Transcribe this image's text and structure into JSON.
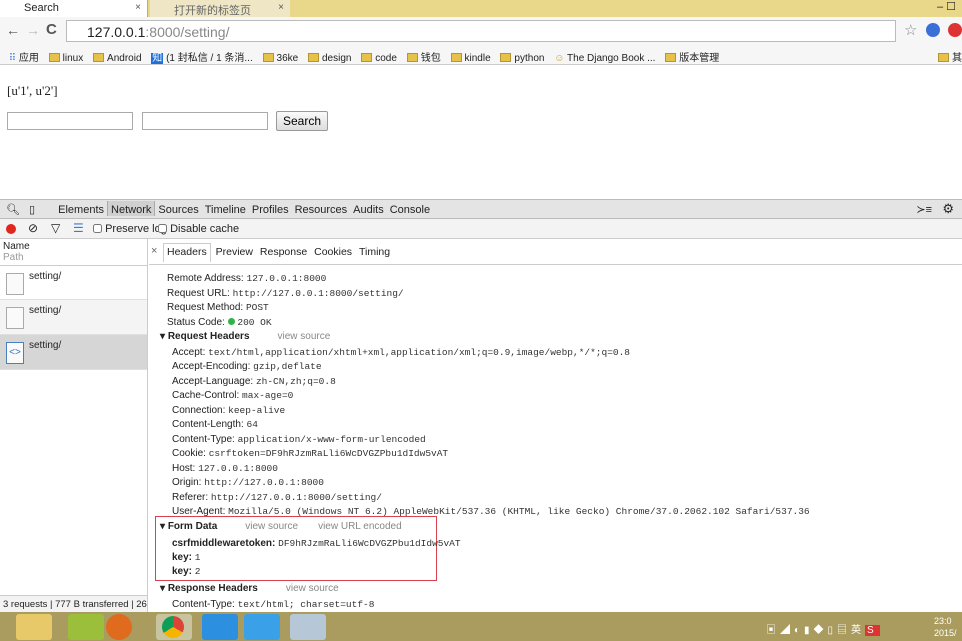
{
  "browser": {
    "tabs": [
      {
        "label": "Search",
        "close": "×"
      },
      {
        "label": "打开新的标签页",
        "close": "×"
      }
    ],
    "url_host": "127.0.0.1",
    "url_rest": ":8000/setting/",
    "bookmarks": [
      "应用",
      "linux",
      "Android",
      "(1 封私信 / 1 条消...",
      "36ke",
      "design",
      "code",
      "钱包",
      "kindle",
      "python",
      "The Django Book ...",
      "版本管理"
    ],
    "bookmarks_other": "其"
  },
  "page": {
    "output": "[u'1', u'2']",
    "input1": "",
    "input2": "",
    "search_button": "Search"
  },
  "devtools": {
    "panels": [
      "Elements",
      "Network",
      "Sources",
      "Timeline",
      "Profiles",
      "Resources",
      "Audits",
      "Console"
    ],
    "active_panel": "Network",
    "preserve_log": "Preserve log",
    "disable_cache": "Disable cache",
    "col_name": "Name",
    "col_path": "Path",
    "requests": [
      "setting/",
      "setting/",
      "setting/"
    ],
    "status_bar": "3 requests | 777 B transferred | 26...",
    "detail_tabs": [
      "Headers",
      "Preview",
      "Response",
      "Cookies",
      "Timing"
    ],
    "general": [
      {
        "k": "Remote Address:",
        "v": "127.0.0.1:8000"
      },
      {
        "k": "Request URL:",
        "v": "http://127.0.0.1:8000/setting/"
      },
      {
        "k": "Request Method:",
        "v": "POST"
      },
      {
        "k": "Status Code:",
        "v": "200 OK"
      }
    ],
    "request_headers_title": "Request Headers",
    "view_source": "view source",
    "view_url_encoded": "view URL encoded",
    "request_headers": [
      {
        "k": "Accept:",
        "v": "text/html,application/xhtml+xml,application/xml;q=0.9,image/webp,*/*;q=0.8"
      },
      {
        "k": "Accept-Encoding:",
        "v": "gzip,deflate"
      },
      {
        "k": "Accept-Language:",
        "v": "zh-CN,zh;q=0.8"
      },
      {
        "k": "Cache-Control:",
        "v": "max-age=0"
      },
      {
        "k": "Connection:",
        "v": "keep-alive"
      },
      {
        "k": "Content-Length:",
        "v": "64"
      },
      {
        "k": "Content-Type:",
        "v": "application/x-www-form-urlencoded"
      },
      {
        "k": "Cookie:",
        "v": "csrftoken=DF9hRJzmRaLli6WcDVGZPbu1dIdw5vAT"
      },
      {
        "k": "Host:",
        "v": "127.0.0.1:8000"
      },
      {
        "k": "Origin:",
        "v": "http://127.0.0.1:8000"
      },
      {
        "k": "Referer:",
        "v": "http://127.0.0.1:8000/setting/"
      },
      {
        "k": "User-Agent:",
        "v": "Mozilla/5.0 (Windows NT 6.2) AppleWebKit/537.36 (KHTML, like Gecko) Chrome/37.0.2062.102 Safari/537.36"
      }
    ],
    "form_data_title": "Form Data",
    "form_data": [
      {
        "k": "csrfmiddlewaretoken:",
        "v": "DF9hRJzmRaLli6WcDVGZPbu1dIdw5vAT"
      },
      {
        "k": "key:",
        "v": "1"
      },
      {
        "k": "key:",
        "v": "2"
      }
    ],
    "response_headers_title": "Response Headers",
    "response_headers": [
      {
        "k": "Content-Type:",
        "v": "text/html; charset=utf-8"
      }
    ]
  },
  "taskbar": {
    "clock_time": "23:0",
    "clock_date": "2015/"
  },
  "colors": {
    "highlight_box": "#d9414f",
    "status_ok": "#2fb34a",
    "record": "#e0261d",
    "taskbar": "#a99c5e"
  }
}
